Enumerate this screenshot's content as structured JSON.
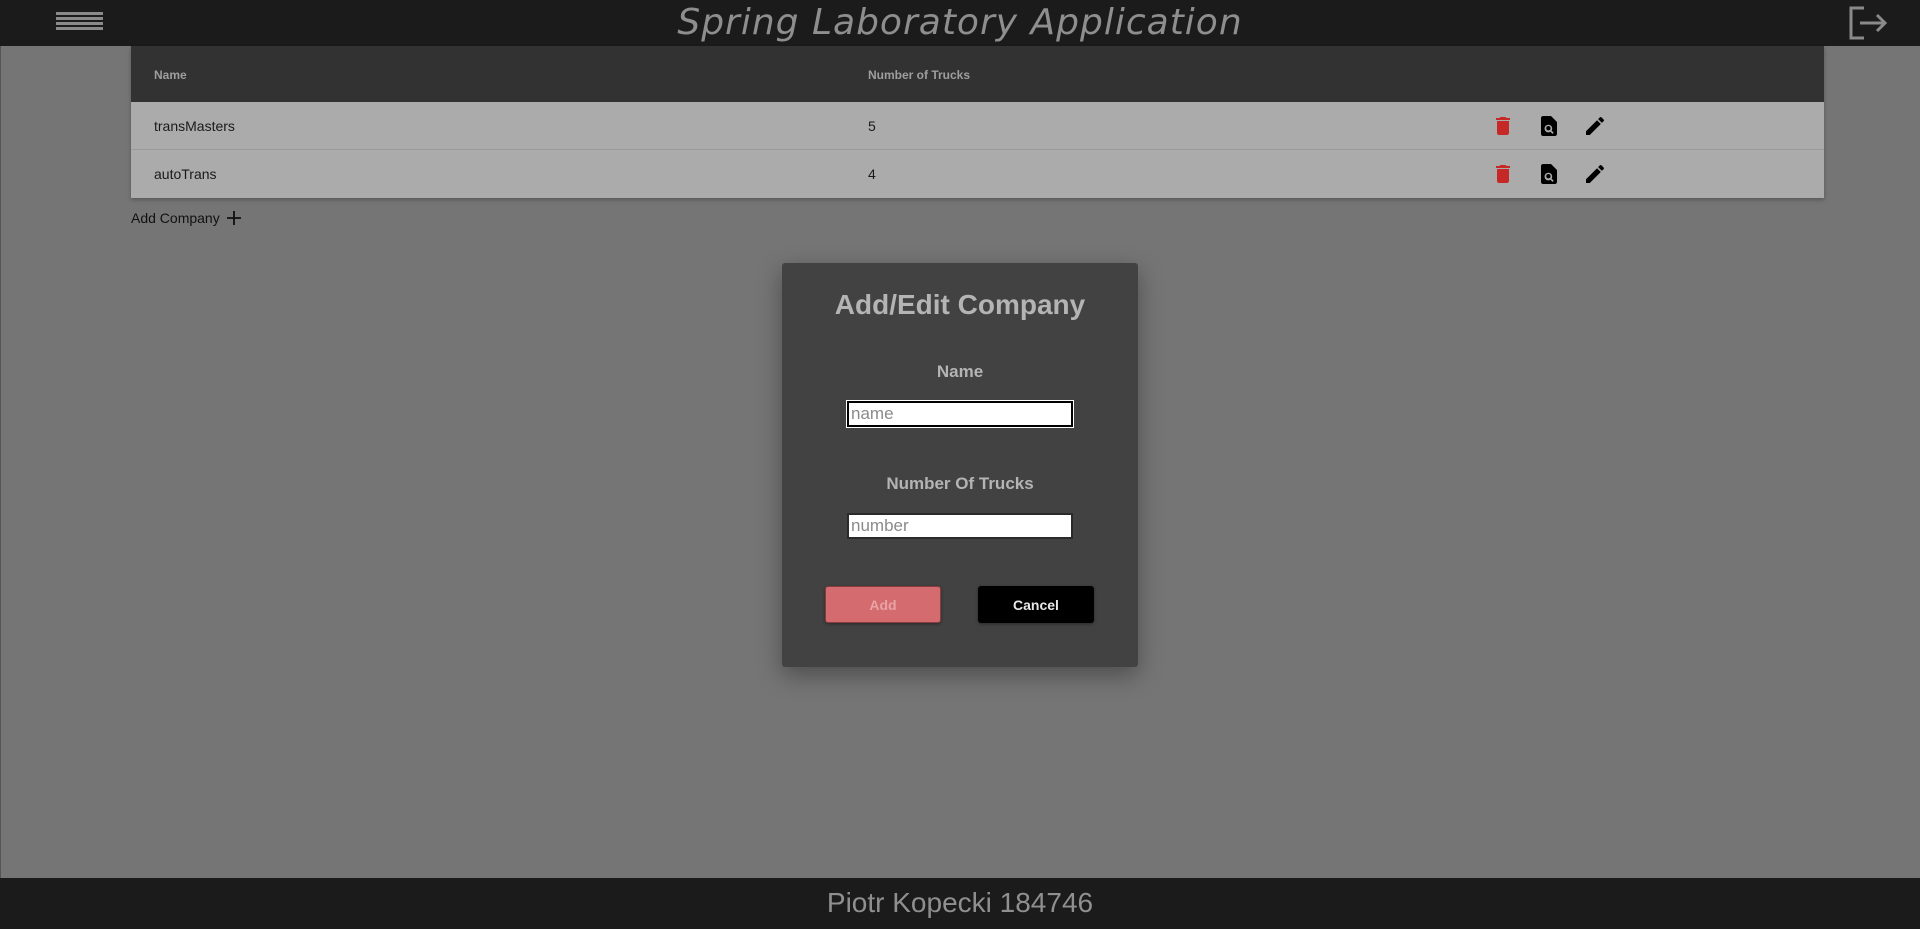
{
  "header": {
    "title": "Spring Laboratory Application",
    "menu_icon": "hamburger-menu-icon",
    "logout_icon": "logout-icon"
  },
  "table": {
    "columns": [
      "Name",
      "Number of Trucks"
    ],
    "rows": [
      {
        "name": "transMasters",
        "trucks": "5"
      },
      {
        "name": "autoTrans",
        "trucks": "4"
      }
    ],
    "row_actions": [
      "delete-icon",
      "view-details-icon",
      "edit-icon"
    ]
  },
  "add_company": {
    "label": "Add Company",
    "icon": "plus-icon"
  },
  "dialog": {
    "title": "Add/Edit Company",
    "name_label": "Name",
    "name_value": "",
    "name_placeholder": "name",
    "trucks_label": "Number Of Trucks",
    "trucks_value": "",
    "trucks_placeholder": "number",
    "add_label": "Add",
    "cancel_label": "Cancel"
  },
  "footer": {
    "text": "Piotr Kopecki 184746"
  },
  "colors": {
    "header_bg": "#1c1b1c",
    "page_bg": "#757575",
    "table_header_bg": "#323232",
    "row_bg": "#ababab",
    "dialog_bg": "#424242",
    "delete_red": "#c62828",
    "add_button": "#d46b6f"
  }
}
